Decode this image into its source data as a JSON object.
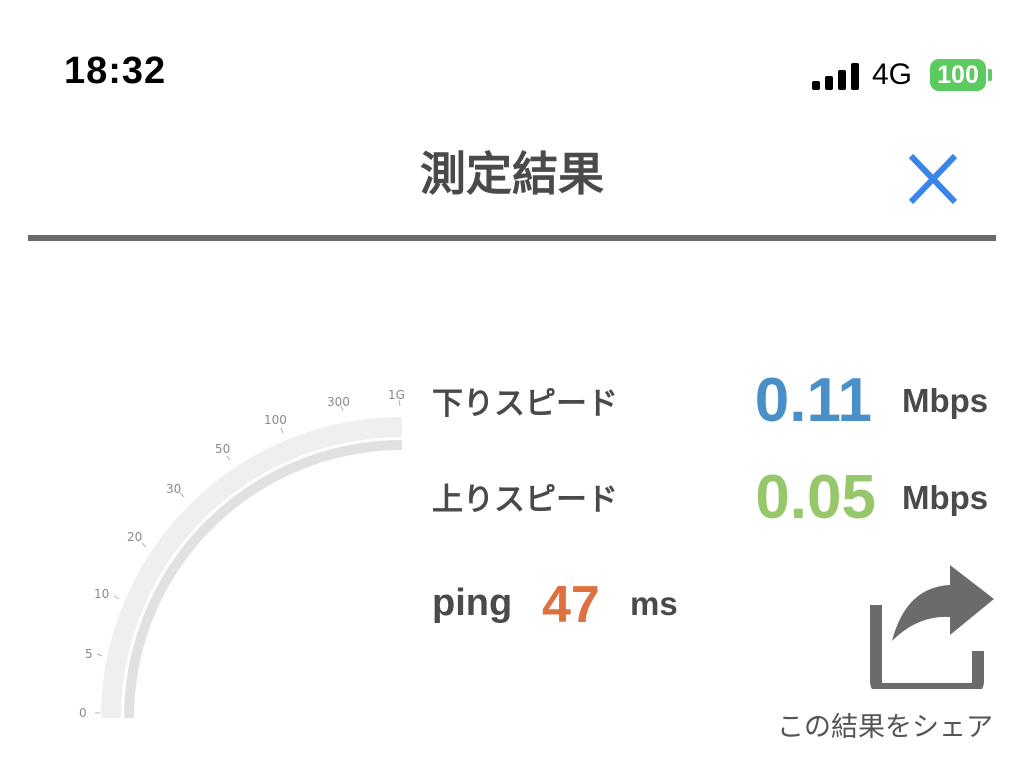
{
  "status_bar": {
    "time": "18:32",
    "network": "4G",
    "battery": "100",
    "battery_color": "#5ccb5f"
  },
  "header": {
    "title": "測定結果",
    "close_icon": "close-icon",
    "close_color": "#3a86e8"
  },
  "gauge": {
    "tick_labels": [
      "0",
      "5",
      "10",
      "20",
      "30",
      "50",
      "100",
      "300",
      "1G"
    ]
  },
  "results": {
    "download": {
      "label": "下りスピード",
      "value": "0.11",
      "unit": "Mbps",
      "color": "#4a90c8"
    },
    "upload": {
      "label": "上りスピード",
      "value": "0.05",
      "unit": "Mbps",
      "color": "#96c76a"
    },
    "ping": {
      "label": "ping",
      "value": "47",
      "unit": "ms",
      "color": "#e0703e"
    }
  },
  "share": {
    "icon": "share-icon",
    "label": "この結果をシェア"
  }
}
